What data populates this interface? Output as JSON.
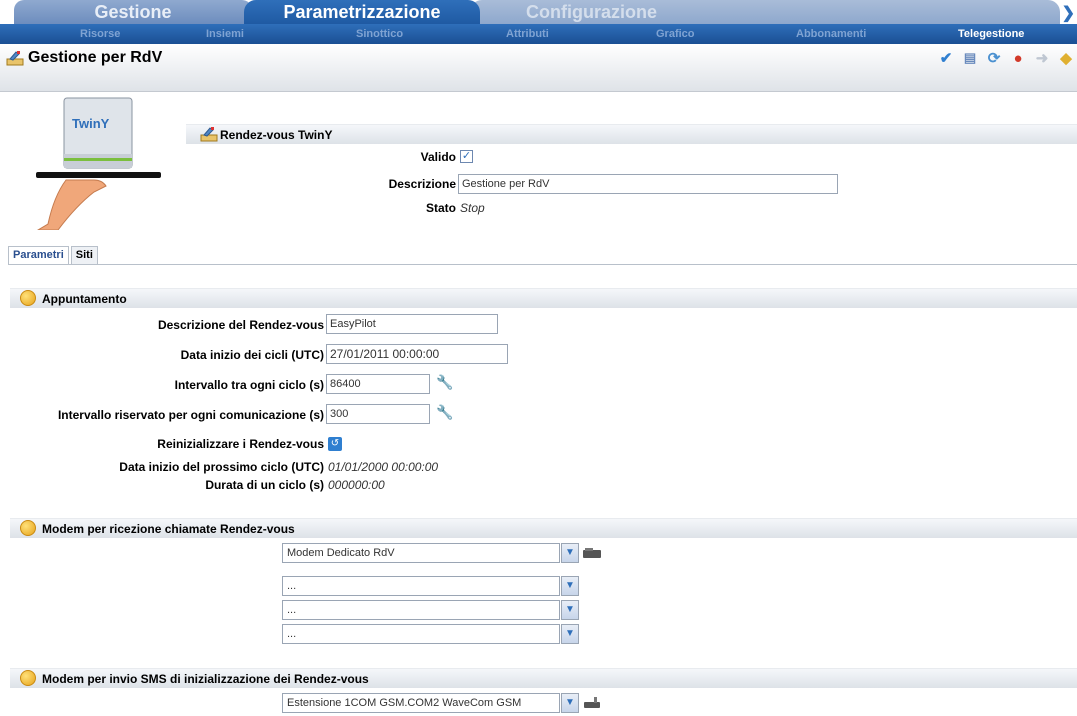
{
  "top_tabs": [
    "Gestione",
    "Parametrizzazione",
    "Configurazione"
  ],
  "sub_menu": [
    "Risorse",
    "Insiemi",
    "Sinottico",
    "Attributi",
    "Grafico",
    "Abbonamenti",
    "Telegestione"
  ],
  "page": {
    "title": "Gestione per RdV"
  },
  "rdv": {
    "title": "Rendez-vous TwinY",
    "valido_label": "Valido",
    "descrizione_label": "Descrizione",
    "descrizione_value": "Gestione per RdV",
    "stato_label": "Stato",
    "stato_value": "Stop"
  },
  "tabs": [
    "Parametri",
    "Siti"
  ],
  "appuntamento": {
    "title": "Appuntamento",
    "desc_label": "Descrizione del Rendez-vous",
    "desc_value": "EasyPilot",
    "data_label": "Data inizio dei cicli (UTC)",
    "data_value": "27/01/2011 00:00:00",
    "intervallo_label": "Intervallo tra ogni ciclo (s)",
    "intervallo_value": "86400",
    "riservato_label": "Intervallo riservato per ogni comunicazione (s)",
    "riservato_value": "300",
    "reinit_label": "Reinizializzare i Rendez-vous",
    "prossimo_label": "Data inizio del prossimo ciclo (UTC)",
    "prossimo_value": "01/01/2000 00:00:00",
    "durata_label": "Durata di un ciclo (s)",
    "durata_value": "000000:00"
  },
  "modem_ricezione": {
    "title": "Modem per ricezione chiamate Rendez-vous",
    "selects": [
      "Modem Dedicato RdV",
      "...",
      "...",
      "..."
    ]
  },
  "modem_sms": {
    "title": "Modem per invio SMS di inizializzazione dei Rendez-vous",
    "select": "Estensione 1COM GSM.COM2 WaveCom GSM"
  },
  "device_logo": "TwinY"
}
